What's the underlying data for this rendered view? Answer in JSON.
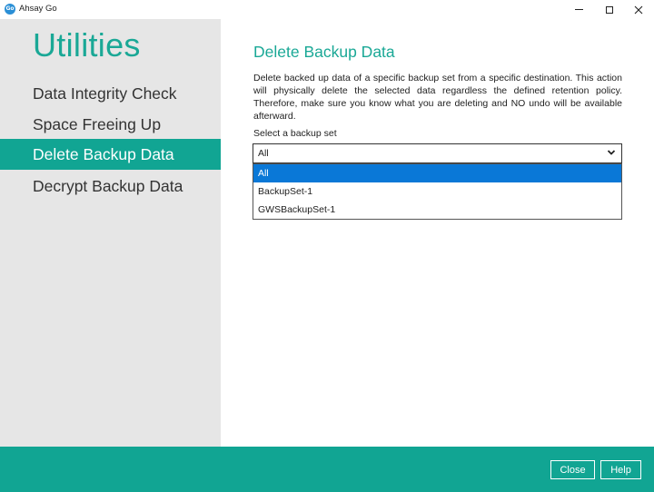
{
  "window": {
    "logo_text": "Go",
    "title": "Ahsay Go"
  },
  "sidebar": {
    "title": "Utilities",
    "items": [
      {
        "label": "Data Integrity Check",
        "active": false
      },
      {
        "label": "Space Freeing Up",
        "active": false
      },
      {
        "label": "Delete Backup Data",
        "active": true
      },
      {
        "label": "Decrypt Backup Data",
        "active": false
      }
    ]
  },
  "content": {
    "title": "Delete Backup Data",
    "description": "Delete backed up data of a specific backup set from a specific destination. This action will physically delete the selected data regardless the defined retention policy. Therefore, make sure you know what you are deleting and NO undo will be available afterward.",
    "select_label": "Select a backup set",
    "select_value": "All",
    "options": [
      {
        "label": "All",
        "selected": true
      },
      {
        "label": "BackupSet-1",
        "selected": false
      },
      {
        "label": "GWSBackupSet-1",
        "selected": false
      }
    ]
  },
  "footer": {
    "close_label": "Close",
    "help_label": "Help"
  },
  "colors": {
    "accent": "#11a593",
    "selection": "#0a78d7",
    "sidebar_bg": "#e6e6e6"
  },
  "icons": {
    "app": "ahsay-go-logo-icon",
    "minimize": "minimize-icon",
    "maximize": "maximize-icon",
    "close": "close-icon",
    "dropdown": "chevron-down-icon"
  }
}
